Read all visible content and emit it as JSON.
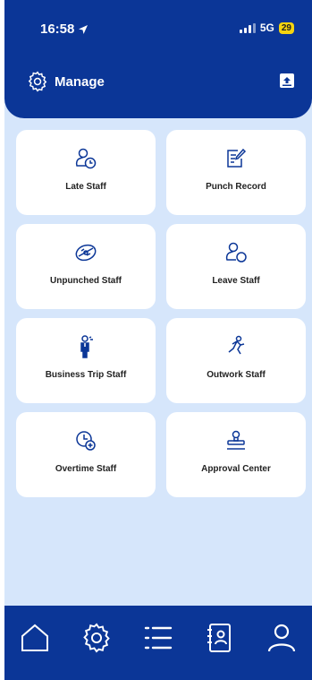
{
  "status_bar": {
    "time": "16:58",
    "network": "5G",
    "battery": "29"
  },
  "header": {
    "title": "Manage",
    "settings_icon": "gear-icon",
    "action_icon": "inbox-icon"
  },
  "colors": {
    "primary": "#0b3697",
    "background": "#d6e6fb",
    "card": "#ffffff",
    "battery": "#f5d40f"
  },
  "tiles": [
    {
      "label": "Late Staff",
      "icon": "person-clock-icon"
    },
    {
      "label": "Punch Record",
      "icon": "edit-document-icon"
    },
    {
      "label": "Unpunched Staff",
      "icon": "badge-icon"
    },
    {
      "label": "Leave Staff",
      "icon": "person-leave-icon"
    },
    {
      "label": "Business Trip Staff",
      "icon": "business-person-icon"
    },
    {
      "label": "Outwork Staff",
      "icon": "running-person-icon"
    },
    {
      "label": "Overtime Staff",
      "icon": "clock-plus-icon"
    },
    {
      "label": "Approval Center",
      "icon": "stamp-icon"
    }
  ],
  "tabbar": {
    "items": [
      "home-icon",
      "settings-icon",
      "list-icon",
      "contacts-icon",
      "profile-icon"
    ]
  }
}
